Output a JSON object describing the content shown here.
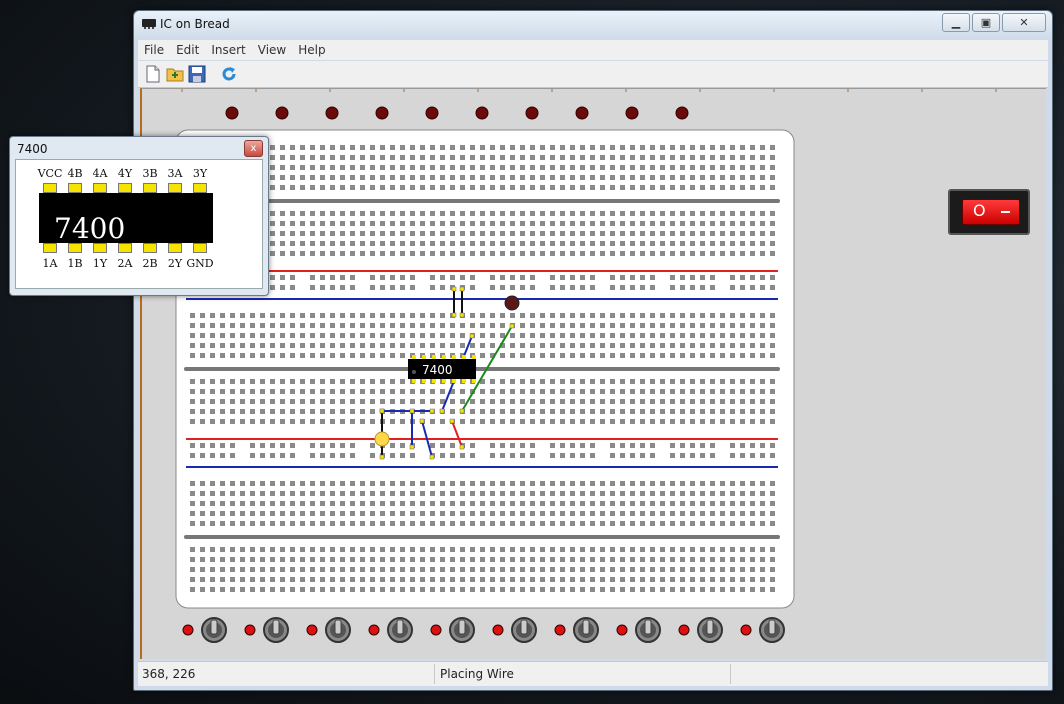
{
  "window": {
    "title": "IC on Bread",
    "minimize_label": "▁",
    "maximize_label": "▣",
    "close_label": "✕"
  },
  "menu": [
    {
      "label": "File"
    },
    {
      "label": "Edit"
    },
    {
      "label": "Insert"
    },
    {
      "label": "View"
    },
    {
      "label": "Help"
    }
  ],
  "toolbar": {
    "icons": [
      "new-file-icon",
      "open-folder-icon",
      "save-icon",
      "refresh-icon"
    ]
  },
  "status": {
    "coordinates": "368, 226",
    "mode": "Placing Wire"
  },
  "ic_popup": {
    "title": "7400",
    "close_label": "x",
    "chip_label": "7400",
    "top_pins": [
      "VCC",
      "4B",
      "4A",
      "4Y",
      "3B",
      "3A",
      "3Y"
    ],
    "bottom_pins": [
      "1A",
      "1B",
      "1Y",
      "2A",
      "2B",
      "2Y",
      "GND"
    ]
  },
  "breadboard": {
    "chip_label": "7400",
    "led_count": 10,
    "toggle_count": 10
  },
  "colors": {
    "rail_red": "#e02020",
    "rail_blue": "#1a2ab0",
    "wire_blue": "#1a2ab0",
    "wire_green": "#1a8a1a",
    "wire_red": "#e02020",
    "wire_black": "#111111",
    "led_dark": "#6a0a0a",
    "led_lit": "#ffd84a",
    "pin_yellow": "#f5e400"
  }
}
